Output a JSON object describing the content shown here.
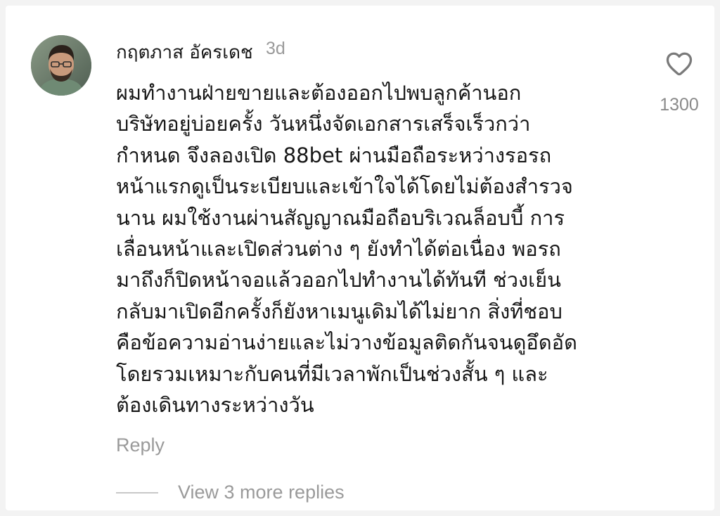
{
  "comment": {
    "author": "กฤตภาส อัครเดช",
    "timestamp": "3d",
    "avatar_icon": "user-avatar-photo",
    "lines": [
      "ผมทำงานฝ่ายขายและต้องออกไปพบลูกค้านอก",
      "บริษัทอยู่บ่อยครั้ง วันหนึ่งจัดเอกสารเสร็จเร็วกว่า",
      "กำหนด จึงลองเปิด 88bet ผ่านมือถือระหว่างรอรถ",
      "หน้าแรกดูเป็นระเบียบและเข้าใจได้โดยไม่ต้องสำรวจ",
      "นาน ผมใช้งานผ่านสัญญาณมือถือบริเวณล็อบบี้ การ",
      "เลื่อนหน้าและเปิดส่วนต่าง ๆ ยังทำได้ต่อเนื่อง พอรถ",
      "มาถึงก็ปิดหน้าจอแล้วออกไปทำงานได้ทันที ช่วงเย็น",
      "กลับมาเปิดอีกครั้งก็ยังหาเมนูเดิมได้ไม่ยาก สิ่งที่ชอบ",
      "คือข้อความอ่านง่ายและไม่วางข้อมูลติดกันจนดูอึดอัด",
      "โดยรวมเหมาะกับคนที่มีเวลาพักเป็นช่วงสั้น ๆ และ",
      "ต้องเดินทางระหว่างวัน"
    ],
    "like_icon": "heart-outline-icon",
    "like_count": "1300",
    "reply_label": "Reply",
    "view_replies_label": "View 3 more replies"
  },
  "colors": {
    "text_primary": "#161616",
    "text_secondary": "#9a9a9a",
    "icon_stroke": "#7a7a7a",
    "background": "#ffffff"
  }
}
